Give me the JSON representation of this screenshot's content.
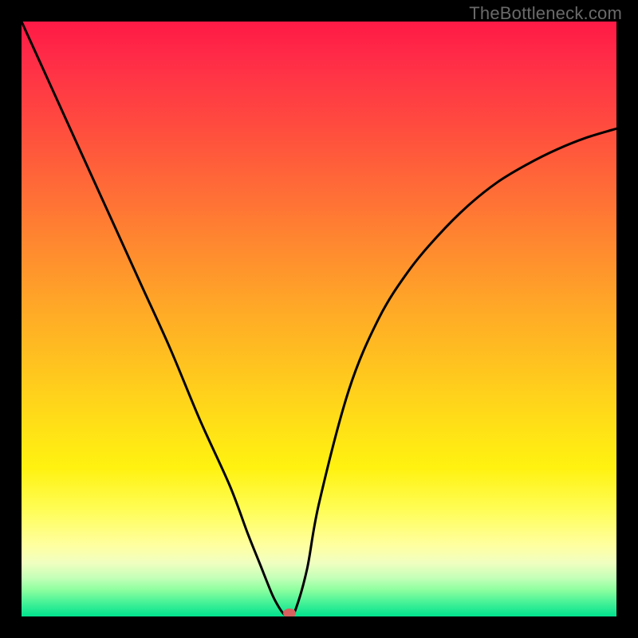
{
  "watermark": "TheBottleneck.com",
  "colors": {
    "frame": "#000000",
    "curve": "#000000",
    "dot": "#d6615f",
    "watermark": "#6a6a6a"
  },
  "chart_data": {
    "type": "line",
    "title": "",
    "xlabel": "",
    "ylabel": "",
    "xlim": [
      0,
      100
    ],
    "ylim": [
      0,
      100
    ],
    "x": [
      0,
      5,
      10,
      15,
      20,
      25,
      30,
      35,
      38,
      40,
      42,
      43,
      44,
      45,
      46,
      48,
      50,
      55,
      60,
      65,
      70,
      75,
      80,
      85,
      90,
      95,
      100
    ],
    "values": [
      100,
      89,
      78,
      67,
      56,
      45,
      33,
      22,
      14,
      9,
      4,
      2,
      0.5,
      0,
      1,
      8,
      19,
      38,
      50,
      58,
      64,
      69,
      73,
      76,
      78.5,
      80.5,
      82
    ],
    "minimum_point": {
      "x": 45,
      "y": 0
    },
    "grid": false,
    "legend": false,
    "annotations": []
  }
}
